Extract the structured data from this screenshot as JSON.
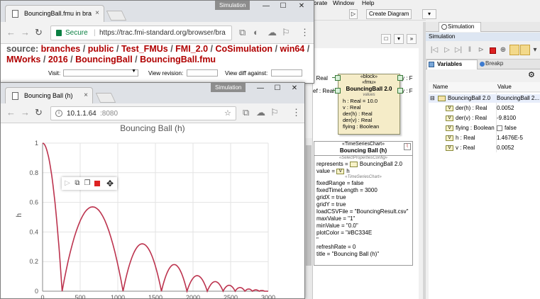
{
  "tool": {
    "menu": [
      "orate",
      "Window",
      "Help"
    ],
    "create_diagram": "Create Diagram",
    "block": {
      "stereo1": "«block»",
      "stereo2": "«fmu»",
      "name": "BouncingBall 2.0",
      "compartment": "values",
      "values": [
        "h : Real = 10.0",
        "v : Real",
        "der(h) : Real",
        "der(v) : Real",
        "flying : Boolean"
      ]
    },
    "left_labels": [
      ": Real",
      "ef : Real"
    ],
    "right_labels": [
      "y : F",
      "v : F"
    ],
    "chart_box": {
      "stereo": "«TimeSeriesChart»",
      "name": "Bouncing Ball (h)",
      "compartment1": "«SelectPropertiesConfig»",
      "represents": "represents = ",
      "represents_val": "BouncingBall 2.0",
      "value": "value = ",
      "value_val": "h",
      "compartment2": "«TimeSeriesChart»",
      "props": [
        "fixedRange = false",
        "fixedTimeLength = 3000",
        "gridX = true",
        "gridY = true",
        "loadCSVFile = \"BouncingResult.csv\"",
        "maxValue = \"1\"",
        "minValue = \"0.0\"",
        "plotColor = \"#BC334E",
        "\"",
        "refreshRate = 0",
        "title = \"Bouncing Ball (h)\""
      ]
    },
    "sim_tab": "Simulation",
    "sim_header": "Simulation",
    "var_tab": "Variables",
    "var_tab2": "Breakp",
    "var_cols": [
      "Name",
      "Value"
    ],
    "var_rows": [
      {
        "name": "BouncingBall 2.0",
        "value": "BouncingBall 2....",
        "level": 0
      },
      {
        "name": "der(h) : Real",
        "value": "0.0052",
        "level": 1
      },
      {
        "name": "der(v) : Real",
        "value": "-9.8100",
        "level": 1
      },
      {
        "name": "flying : Boolean",
        "value": "false",
        "level": 1
      },
      {
        "name": "h : Real",
        "value": "1.4676E-5",
        "level": 1
      },
      {
        "name": "v : Real",
        "value": "0.0052",
        "level": 1
      }
    ]
  },
  "win1": {
    "tab_title": "BouncingBall.fmu in bra",
    "badge": "Simulation",
    "secure": "Secure",
    "url": "https://trac.fmi-standard.org/browser/bra",
    "breadcrumb_label": "source:",
    "breadcrumb": [
      "branches",
      "public",
      "Test_FMUs",
      "FMI_2.0",
      "CoSimulation",
      "win64",
      "MWorks",
      "2016",
      "BouncingBall",
      "BouncingBall.fmu"
    ],
    "visit": "Visit:",
    "view_revision": "View revision:",
    "view_diff": "View diff against:"
  },
  "win2": {
    "tab_title": "Bouncing Ball (h)",
    "badge": "Simulation",
    "url_host": "10.1.1.64",
    "url_port": ":8080"
  },
  "chart_data": {
    "type": "line",
    "title": "Bouncing Ball (h)",
    "xlabel": "",
    "ylabel": "h",
    "xlim": [
      0,
      3000
    ],
    "ylim": [
      0,
      1
    ],
    "x_ticks": [
      0,
      500,
      1000,
      1500,
      2000,
      2500,
      3000
    ],
    "y_ticks": [
      0,
      0.2,
      0.4,
      0.6,
      0.8,
      1
    ],
    "grid": true,
    "color": "#BC334E",
    "bounces": [
      {
        "x_start": 0,
        "x_end": 260,
        "peak": 1.0
      },
      {
        "x_start": 260,
        "x_end": 1070,
        "peak": 0.57
      },
      {
        "x_start": 1070,
        "x_end": 1580,
        "peak": 0.32
      },
      {
        "x_start": 1580,
        "x_end": 1920,
        "peak": 0.18
      },
      {
        "x_start": 1920,
        "x_end": 2190,
        "peak": 0.105
      },
      {
        "x_start": 2190,
        "x_end": 2400,
        "peak": 0.065
      },
      {
        "x_start": 2400,
        "x_end": 2560,
        "peak": 0.04
      },
      {
        "x_start": 2560,
        "x_end": 2690,
        "peak": 0.025
      },
      {
        "x_start": 2690,
        "x_end": 2790,
        "peak": 0.015
      },
      {
        "x_start": 2790,
        "x_end": 2880,
        "peak": 0.009
      },
      {
        "x_start": 2880,
        "x_end": 2950,
        "peak": 0.005
      }
    ]
  }
}
